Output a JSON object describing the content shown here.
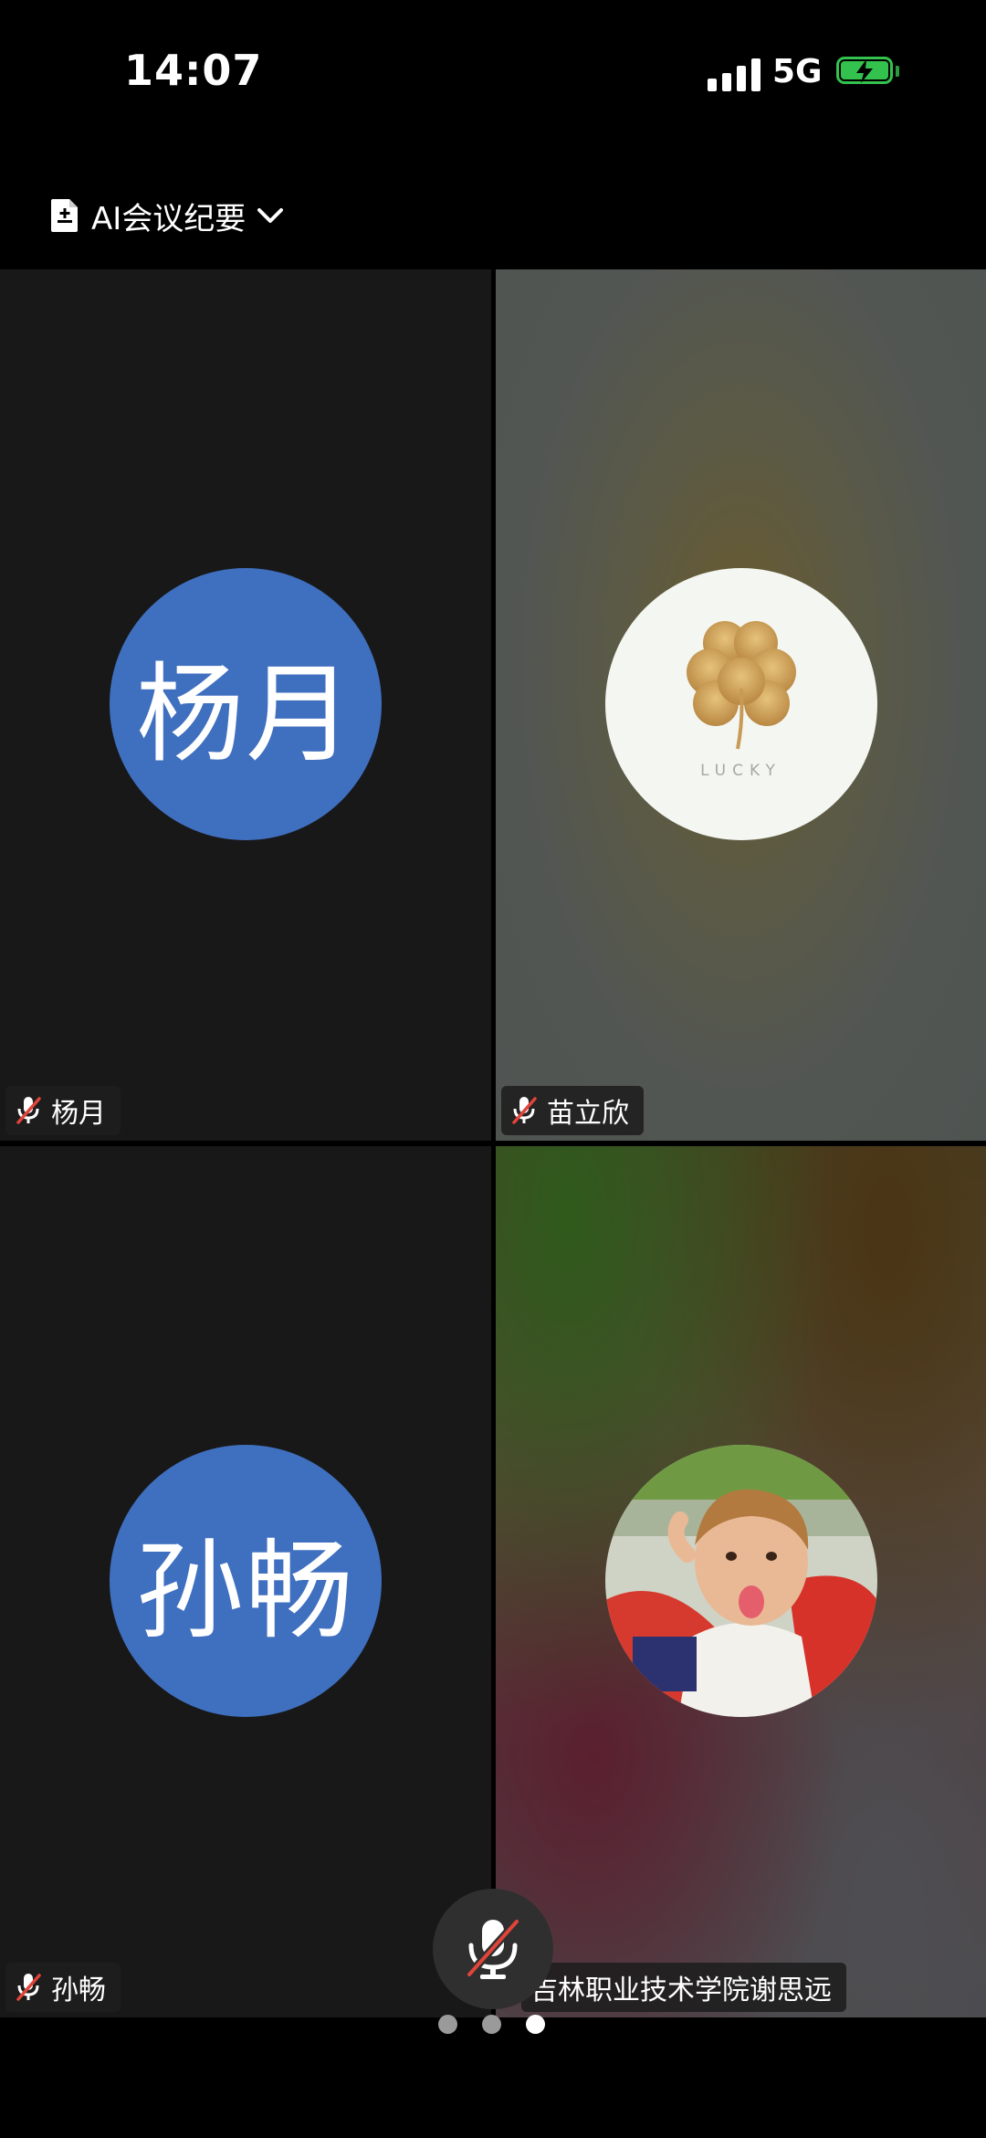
{
  "status_bar": {
    "time": "14:07",
    "network": "5G",
    "battery_charging": true
  },
  "header": {
    "ai_summary_label": "AI会议纪要"
  },
  "participants": [
    {
      "name": "杨月",
      "avatar_text": "杨月",
      "avatar_color": "#3f6fbf",
      "muted": true
    },
    {
      "name": "苗立欣",
      "avatar_image": "lucky clover logo",
      "avatar_caption": "LUCKY",
      "muted": true
    },
    {
      "name": "孙畅",
      "avatar_text": "孙畅",
      "avatar_color": "#3f6fbf",
      "muted": true
    },
    {
      "name": "吉林职业技术学院谢思远",
      "avatar_image": "child photo",
      "muted": false
    }
  ],
  "controls": {
    "mic_muted": true
  },
  "pager": {
    "pages": 3,
    "current": 3
  },
  "colors": {
    "background": "#000000",
    "tile": "#181818",
    "mute_slash": "#e0443a",
    "battery": "#33c24d"
  }
}
